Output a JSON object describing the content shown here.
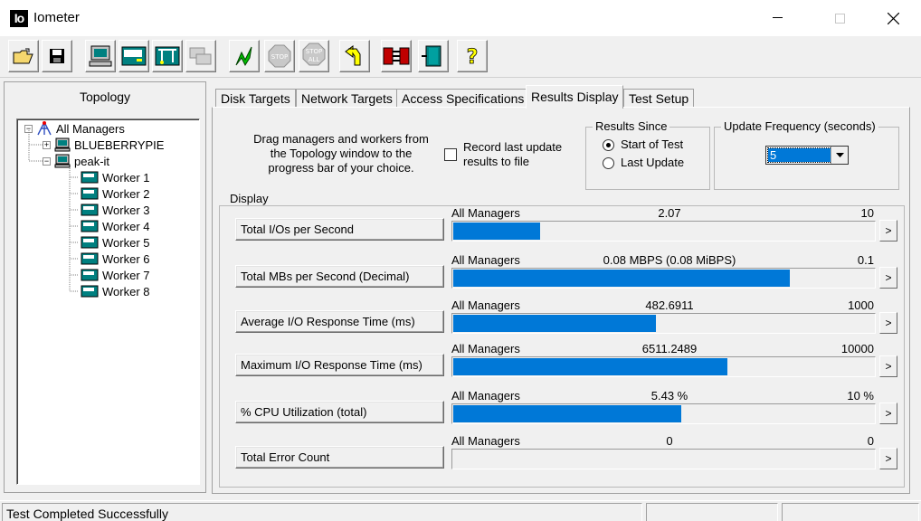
{
  "window": {
    "title": "Iometer",
    "icon_text": "Io"
  },
  "toolbar": {
    "buttons": [
      "open-config",
      "save-config",
      "start-new-manager",
      "start-new-disk-worker",
      "start-new-network-worker",
      "duplicate-worker",
      "start-tests",
      "stop-test",
      "stop-all",
      "reset-workers",
      "exit-managers",
      "exit",
      "about"
    ]
  },
  "topology": {
    "title": "Topology",
    "root": "All Managers",
    "managers": [
      {
        "name": "BLUEBERRYPIE",
        "expanded": false
      },
      {
        "name": "peak-it",
        "expanded": true,
        "workers": [
          "Worker 1",
          "Worker 2",
          "Worker 3",
          "Worker 4",
          "Worker 5",
          "Worker 6",
          "Worker 7",
          "Worker 8"
        ]
      }
    ]
  },
  "tabs": [
    {
      "label": "Disk Targets"
    },
    {
      "label": "Network Targets"
    },
    {
      "label": "Access Specifications"
    },
    {
      "label": "Results Display",
      "active": true
    },
    {
      "label": "Test Setup"
    }
  ],
  "results": {
    "drag_hint": "Drag managers and workers from the Topology window to the progress bar of your choice.",
    "record_label": "Record last update results to file",
    "record_checked": false,
    "results_since": {
      "legend": "Results Since",
      "options": [
        "Start of Test",
        "Last Update"
      ],
      "selected": "Start of Test"
    },
    "update_frequency": {
      "legend": "Update Frequency (seconds)",
      "value": "5"
    },
    "display_legend": "Display",
    "metrics": [
      {
        "label": "Total I/Os per Second",
        "target": "All Managers",
        "value": "2.07",
        "max": "10",
        "fill": 0.207
      },
      {
        "label": "Total MBs per Second (Decimal)",
        "target": "All Managers",
        "value": "0.08 MBPS (0.08 MiBPS)",
        "max": "0.1",
        "fill": 0.8
      },
      {
        "label": "Average I/O Response Time (ms)",
        "target": "All Managers",
        "value": "482.6911",
        "max": "1000",
        "fill": 0.4827
      },
      {
        "label": "Maximum I/O Response Time (ms)",
        "target": "All Managers",
        "value": "6511.2489",
        "max": "10000",
        "fill": 0.6511
      },
      {
        "label": "% CPU Utilization (total)",
        "target": "All Managers",
        "value": "5.43 %",
        "max": "10 %",
        "fill": 0.543
      },
      {
        "label": "Total Error Count",
        "target": "All Managers",
        "value": "0",
        "max": "0",
        "fill": 0
      }
    ],
    "go_button_label": ">"
  },
  "status": {
    "text": "Test Completed Successfully"
  },
  "colors": {
    "accent": "#0078d7"
  }
}
